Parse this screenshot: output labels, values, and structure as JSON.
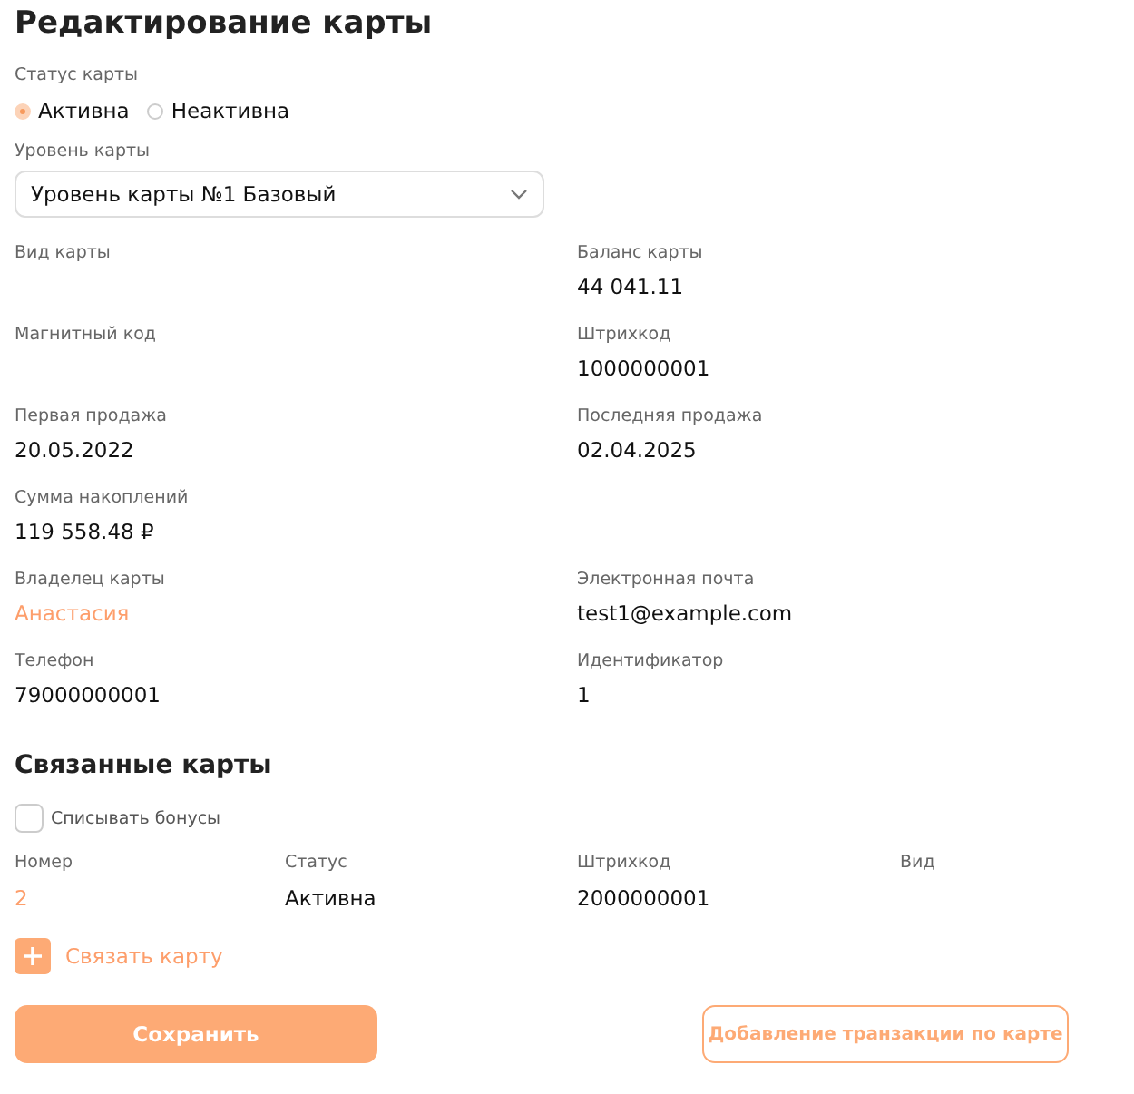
{
  "title": "Редактирование карты",
  "status": {
    "label": "Статус карты",
    "options": [
      {
        "label": "Активна",
        "selected": true
      },
      {
        "label": "Неактивна",
        "selected": false
      }
    ]
  },
  "level": {
    "label": "Уровень карты",
    "value": "Уровень карты №1 Базовый"
  },
  "field_rows": [
    {
      "cells": [
        {
          "label": "Вид карты"
        },
        {
          "label": "Баланс карты",
          "value": "44 041.11"
        }
      ]
    },
    {
      "cells": [
        {
          "label": "Магнитный код"
        },
        {
          "label": "Штрихкод",
          "value": "1000000001"
        }
      ]
    },
    {
      "cells": [
        {
          "label": "Первая продажа",
          "value": "20.05.2022"
        },
        {
          "label": "Последняя продажа",
          "value": "02.04.2025"
        }
      ]
    },
    {
      "cells": [
        {
          "label": "Сумма накоплений",
          "value": "119 558.48 ₽"
        }
      ]
    },
    {
      "cells": [
        {
          "label": "Владелец карты",
          "value": "Анастасия",
          "kind": "link"
        },
        {
          "label": "Электронная почта",
          "value": "test1@example.com"
        }
      ]
    },
    {
      "cells": [
        {
          "label": "Телефон",
          "value": "79000000001"
        },
        {
          "label": "Идентификатор",
          "value": "1"
        }
      ]
    }
  ],
  "linked": {
    "title": "Связанные карты",
    "write_off": {
      "label": "Списывать бонусы",
      "checked": false
    },
    "columns": [
      "Номер",
      "Статус",
      "Штрихкод",
      "Вид"
    ],
    "rows": [
      {
        "cells": [
          "2",
          "Активна",
          "2000000001",
          ""
        ]
      }
    ],
    "add_label": "Связать карту"
  },
  "buttons": {
    "save": "Сохранить",
    "transaction": "Добавление транзакции по карте"
  }
}
